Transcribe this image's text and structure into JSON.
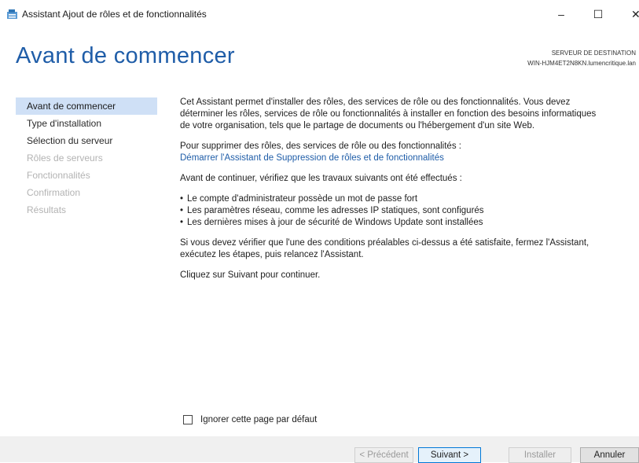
{
  "window": {
    "title": "Assistant Ajout de rôles et de fonctionnalités",
    "minimize": "–",
    "maximize": "☐",
    "close": "✕"
  },
  "page": {
    "heading": "Avant de commencer",
    "destination_label": "SERVEUR DE DESTINATION",
    "destination_server": "WIN-HJM4ET2N8KN.lumencritique.lan"
  },
  "sidebar": {
    "items": [
      {
        "label": "Avant de commencer",
        "state": "active"
      },
      {
        "label": "Type d'installation",
        "state": "enabled"
      },
      {
        "label": "Sélection du serveur",
        "state": "enabled"
      },
      {
        "label": "Rôles de serveurs",
        "state": "disabled"
      },
      {
        "label": "Fonctionnalités",
        "state": "disabled"
      },
      {
        "label": "Confirmation",
        "state": "disabled"
      },
      {
        "label": "Résultats",
        "state": "disabled"
      }
    ]
  },
  "content": {
    "intro_line1": "Cet Assistant permet d'installer des rôles, des services de rôle ou des fonctionnalités. Vous devez",
    "intro_line2": "déterminer les rôles, services de rôle ou fonctionnalités à installer en fonction des besoins informatiques",
    "intro_line3": "de votre organisation, tels que le partage de documents ou l'hébergement d'un site Web.",
    "remove_text": "Pour supprimer des rôles, des services de rôle ou des fonctionnalités :",
    "remove_link": "Démarrer l'Assistant de Suppression de rôles et de fonctionnalités",
    "verify_text": "Avant de continuer, vérifiez que les travaux suivants ont été effectués :",
    "bullets": [
      "Le compte d'administrateur possède un mot de passe fort",
      "Les paramètres réseau, comme les adresses IP statiques, sont configurés",
      "Les dernières mises à jour de sécurité de Windows Update sont installées"
    ],
    "prereq_line1": "Si vous devez vérifier que l'une des conditions préalables ci-dessus a été satisfaite, fermez l'Assistant,",
    "prereq_line2": "exécutez les étapes, puis relancez l'Assistant.",
    "continue_text": "Cliquez sur Suivant pour continuer."
  },
  "ignore_checkbox": {
    "label": "Ignorer cette page par défaut",
    "checked": false
  },
  "buttons": {
    "previous": "< Précédent",
    "next": "Suivant >",
    "install": "Installer",
    "cancel": "Annuler"
  },
  "colors": {
    "heading": "#1f5da8",
    "link": "#1f5da8",
    "active_nav_bg": "#cfe0f6",
    "footer_bg": "#f0f0f0"
  }
}
